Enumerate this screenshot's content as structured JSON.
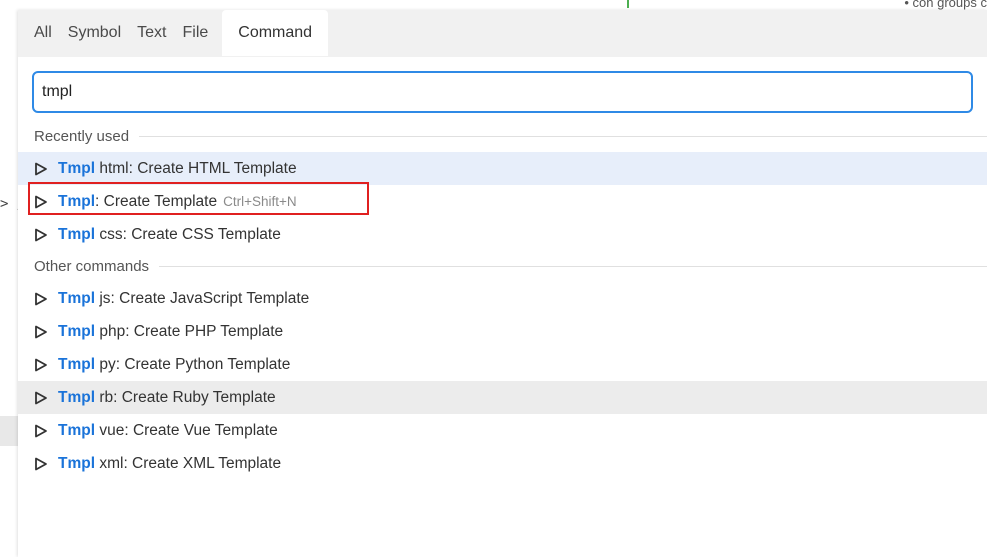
{
  "background": {
    "left_code_fragment": "> ;",
    "top_right_fragment": "• con groups c"
  },
  "tabs": [
    {
      "label": "All",
      "active": false
    },
    {
      "label": "Symbol",
      "active": false
    },
    {
      "label": "Text",
      "active": false
    },
    {
      "label": "File",
      "active": false
    },
    {
      "label": "Command",
      "active": true
    }
  ],
  "search": {
    "value": "tmpl",
    "placeholder": ""
  },
  "sections": {
    "recent": {
      "title": "Recently used",
      "items": [
        {
          "kw": "Tmpl",
          "rest": " html: Create HTML Template",
          "shortcut": "",
          "state": "selected"
        },
        {
          "kw": "Tmpl",
          "rest": ": Create Template",
          "shortcut": "Ctrl+Shift+N",
          "state": "highlighted"
        },
        {
          "kw": "Tmpl",
          "rest": " css: Create CSS Template",
          "shortcut": "",
          "state": ""
        }
      ]
    },
    "other": {
      "title": "Other commands",
      "items": [
        {
          "kw": "Tmpl",
          "rest": " js: Create JavaScript Template",
          "shortcut": "",
          "state": ""
        },
        {
          "kw": "Tmpl",
          "rest": " php: Create PHP Template",
          "shortcut": "",
          "state": ""
        },
        {
          "kw": "Tmpl",
          "rest": " py: Create Python Template",
          "shortcut": "",
          "state": ""
        },
        {
          "kw": "Tmpl",
          "rest": " rb: Create Ruby Template",
          "shortcut": "",
          "state": "hover"
        },
        {
          "kw": "Tmpl",
          "rest": " vue: Create Vue Template",
          "shortcut": "",
          "state": ""
        },
        {
          "kw": "Tmpl",
          "rest": " xml: Create XML Template",
          "shortcut": "",
          "state": ""
        }
      ]
    }
  },
  "icons": {
    "run": "play-outline-icon"
  },
  "colors": {
    "accent": "#2f8ae6",
    "keyword": "#1a73d9",
    "selected_row": "#e7eefa",
    "hover_row": "#ececec",
    "highlight_box": "#e02020"
  }
}
